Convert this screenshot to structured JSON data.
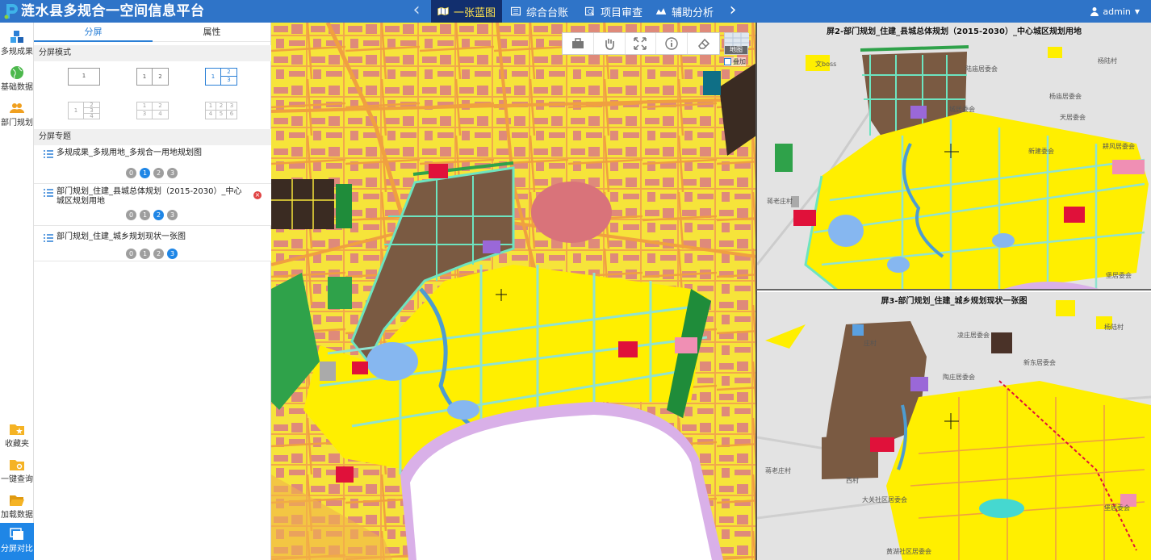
{
  "app": {
    "title": "涟水县多规合一空间信息平台",
    "user": "admin"
  },
  "nav": {
    "tabs": [
      {
        "label": "一张蓝图",
        "icon": "map-icon"
      },
      {
        "label": "综合台账",
        "icon": "ledger-icon"
      },
      {
        "label": "项目审查",
        "icon": "review-icon"
      },
      {
        "label": "辅助分析",
        "icon": "analysis-icon"
      }
    ]
  },
  "rail": {
    "top": [
      {
        "label": "多规成果",
        "icon": "cubes-icon"
      },
      {
        "label": "基础数据",
        "icon": "globe-icon"
      },
      {
        "label": "部门规划",
        "icon": "users-icon"
      }
    ],
    "bottom": [
      {
        "label": "收藏夹",
        "icon": "folder-star-icon"
      },
      {
        "label": "一键查询",
        "icon": "folder-search-icon"
      },
      {
        "label": "加载数据",
        "icon": "folder-open-icon"
      },
      {
        "label": "分屏对比",
        "icon": "split-screen-icon"
      }
    ]
  },
  "panel": {
    "tabs": [
      "分屏",
      "属性"
    ],
    "mode_header": "分屏模式",
    "topic_header": "分屏专题",
    "modes": [
      {
        "cells": [
          "1"
        ]
      },
      {
        "cells": [
          "1",
          "2"
        ]
      },
      {
        "cells": [
          "1",
          "2",
          "3"
        ]
      },
      {
        "cells": [
          "1",
          "2",
          "3",
          "4"
        ]
      },
      {
        "cells": [
          "1",
          "2",
          "3",
          "4"
        ]
      },
      {
        "cells": [
          "1",
          "2",
          "3",
          "4",
          "5",
          "6"
        ]
      }
    ],
    "topics": [
      {
        "title": "多规成果_多规用地_多规合一用地规划图",
        "pages": [
          "0",
          "1",
          "2",
          "3"
        ],
        "active_page": "1"
      },
      {
        "title": "部门规划_住建_县城总体规划（2015-2030）_中心城区规划用地",
        "pages": [
          "0",
          "1",
          "2",
          "3"
        ],
        "active_page": "2"
      },
      {
        "title": "部门规划_住建_城乡规划现状一张图",
        "pages": [
          "0",
          "1",
          "2",
          "3"
        ],
        "active_page": "3"
      }
    ],
    "close_glyph": "×"
  },
  "map": {
    "basemap_label": "地图",
    "overlay_label": "叠加",
    "tools": [
      "toolbox-icon",
      "pan-icon",
      "extent-icon",
      "info-icon",
      "eraser-icon"
    ]
  },
  "pane2": {
    "title": "屏2-部门规划_住建_县城总体规划（2015-2030）_中心城区规划用地",
    "labels": [
      "文boss",
      "陆庙居委会",
      "城居委会",
      "杨陆村",
      "杨庙居委会",
      "新建委会",
      "天居委会",
      "耕风居委会",
      "蒋老庄村",
      "堡居委会"
    ]
  },
  "pane3": {
    "title": "屏3-部门规划_住建_城乡规划现状一张图",
    "labels": [
      "庄村",
      "凌庄居委会",
      "杨陆村",
      "蒋老庄村",
      "陶庄居委会",
      "新东居委会",
      "大关社区居委会",
      "西村",
      "堡居委会",
      "黄湖社区居委会"
    ]
  }
}
